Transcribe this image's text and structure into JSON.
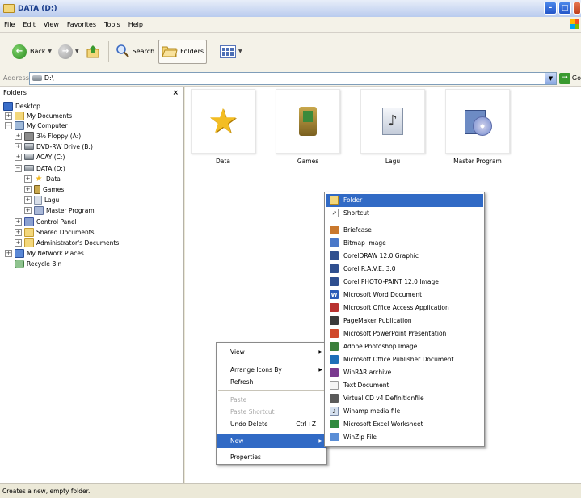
{
  "window": {
    "title": "DATA (D:)"
  },
  "menu": [
    "File",
    "Edit",
    "View",
    "Favorites",
    "Tools",
    "Help"
  ],
  "toolbar": {
    "back_label": "Back",
    "search_label": "Search",
    "folders_label": "Folders"
  },
  "address": {
    "label": "Address",
    "value": "D:\\",
    "go_label": "Go"
  },
  "folders_pane": {
    "title": "Folders",
    "close_glyph": "×",
    "tree": [
      {
        "label": "Desktop",
        "icon": "desktop-icon",
        "expander": ""
      },
      {
        "label": "My Documents",
        "icon": "folder-icon",
        "expander": "+"
      },
      {
        "label": "My Computer",
        "icon": "my-computer-icon",
        "expander": "−"
      },
      {
        "label": "3½ Floppy (A:)",
        "icon": "floppy-icon",
        "expander": "+"
      },
      {
        "label": "DVD-RW Drive (B:)",
        "icon": "dvd-drive-icon",
        "expander": "+"
      },
      {
        "label": "ACAY (C:)",
        "icon": "drive-icon",
        "expander": "+"
      },
      {
        "label": "DATA (D:)",
        "icon": "drive-icon",
        "expander": "−"
      },
      {
        "label": "Data",
        "icon": "star-icon",
        "expander": "+"
      },
      {
        "label": "Games",
        "icon": "games-icon",
        "expander": "+"
      },
      {
        "label": "Lagu",
        "icon": "music-icon",
        "expander": "+"
      },
      {
        "label": "Master Program",
        "icon": "master-program-icon",
        "expander": "+"
      },
      {
        "label": "Control Panel",
        "icon": "control-panel-icon",
        "expander": "+"
      },
      {
        "label": "Shared Documents",
        "icon": "folder-icon",
        "expander": "+"
      },
      {
        "label": "Administrator's Documents",
        "icon": "folder-icon",
        "expander": "+"
      },
      {
        "label": "My Network Places",
        "icon": "network-icon",
        "expander": "+"
      },
      {
        "label": "Recycle Bin",
        "icon": "recycle-bin-icon",
        "expander": ""
      }
    ]
  },
  "content": {
    "items": [
      {
        "label": "Data",
        "icon": "star-icon"
      },
      {
        "label": "Games",
        "icon": "games-icon"
      },
      {
        "label": "Lagu",
        "icon": "music-icon"
      },
      {
        "label": "Master Program",
        "icon": "master-program-icon"
      }
    ]
  },
  "context_menu": {
    "items": [
      {
        "label": "View",
        "submenu": true,
        "disabled": false
      },
      {
        "label": "Arrange Icons By",
        "submenu": true,
        "disabled": false
      },
      {
        "label": "Refresh",
        "submenu": false,
        "disabled": false
      },
      {
        "label": "Paste",
        "submenu": false,
        "disabled": true
      },
      {
        "label": "Paste Shortcut",
        "submenu": false,
        "disabled": true
      },
      {
        "label": "Undo Delete",
        "shortcut": "Ctrl+Z",
        "submenu": false,
        "disabled": false
      },
      {
        "label": "New",
        "submenu": true,
        "disabled": false,
        "highlighted": true
      },
      {
        "label": "Properties",
        "submenu": false,
        "disabled": false
      }
    ]
  },
  "new_submenu": {
    "items": [
      {
        "label": "Folder",
        "icon": "folder-icon",
        "color": "#f3d77b",
        "highlighted": true
      },
      {
        "label": "Shortcut",
        "icon": "shortcut-icon",
        "color": "#ffffff"
      },
      {
        "label": "Briefcase",
        "icon": "briefcase-icon",
        "color": "#c9782e"
      },
      {
        "label": "Bitmap Image",
        "icon": "bitmap-icon",
        "color": "#4a78c9"
      },
      {
        "label": "CorelDRAW 12.0 Graphic",
        "icon": "coreldraw-icon",
        "color": "#2f4f8f"
      },
      {
        "label": "Corel R.A.V.E. 3.0",
        "icon": "corel-rave-icon",
        "color": "#2f4f8f"
      },
      {
        "label": "Corel PHOTO-PAINT 12.0 Image",
        "icon": "corel-photopaint-icon",
        "color": "#2f4f8f"
      },
      {
        "label": "Microsoft Word Document",
        "icon": "word-icon",
        "color": "#2b5bb8"
      },
      {
        "label": "Microsoft Office Access Application",
        "icon": "access-icon",
        "color": "#b8312f"
      },
      {
        "label": "PageMaker Publication",
        "icon": "pagemaker-icon",
        "color": "#3a3a3a"
      },
      {
        "label": "Microsoft PowerPoint Presentation",
        "icon": "powerpoint-icon",
        "color": "#d0482a"
      },
      {
        "label": "Adobe Photoshop Image",
        "icon": "photoshop-icon",
        "color": "#3b7f3b"
      },
      {
        "label": "Microsoft Office Publisher Document",
        "icon": "publisher-icon",
        "color": "#1e6fb8"
      },
      {
        "label": "WinRAR archive",
        "icon": "winrar-icon",
        "color": "#7a3a8f"
      },
      {
        "label": "Text Document",
        "icon": "text-document-icon",
        "color": "#e9e9e9"
      },
      {
        "label": "Virtual CD v4 Definitionfile",
        "icon": "virtual-cd-icon",
        "color": "#5a5a5a"
      },
      {
        "label": "Winamp media file",
        "icon": "winamp-icon",
        "color": "#d5e0ef"
      },
      {
        "label": "Microsoft Excel Worksheet",
        "icon": "excel-icon",
        "color": "#2f8a3e"
      },
      {
        "label": "WinZip File",
        "icon": "winzip-icon",
        "color": "#5a8ed6"
      }
    ]
  },
  "status": {
    "text": "Creates a new, empty folder."
  }
}
